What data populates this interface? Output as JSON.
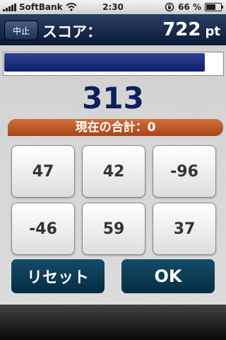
{
  "status_bar": {
    "carrier": "SoftBank",
    "time": "2:30",
    "battery_text": "66 %",
    "battery_level": 0.66
  },
  "header": {
    "quit_label": "中止",
    "score_label": "スコア：",
    "score_value": "722",
    "score_unit": "pt"
  },
  "progress": {
    "value": 0.92
  },
  "target_number": "313",
  "current_sum_text": "現在の合計：0",
  "tiles": [
    "47",
    "42",
    "-96",
    "-46",
    "59",
    "37"
  ],
  "buttons": {
    "reset_label": "リセット",
    "ok_label": "OK"
  },
  "colors": {
    "header": "#0b1a38",
    "accent_blue": "#0e1f5c",
    "sum_banner": "#c05a2a",
    "action_button": "#0a3a55"
  }
}
